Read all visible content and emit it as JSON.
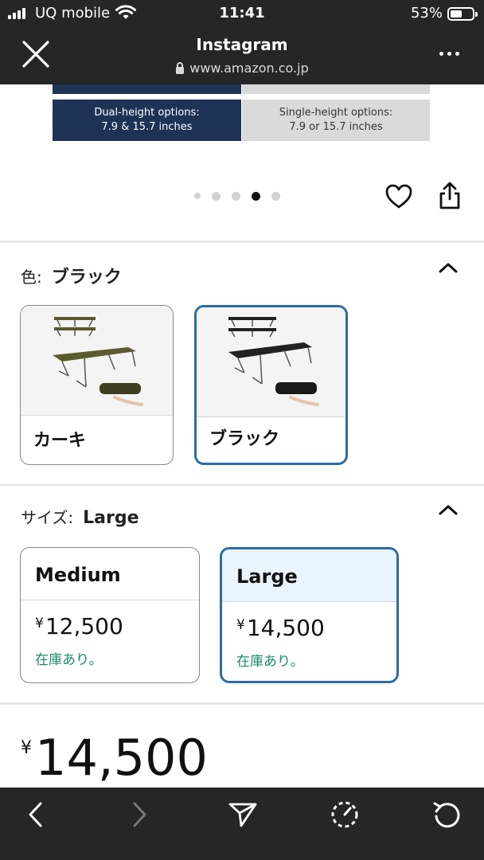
{
  "status_bar": {
    "carrier": "UQ mobile",
    "time": "11:41",
    "battery_pct": "53%",
    "battery_level": 0.53
  },
  "browser": {
    "title": "Instagram",
    "url": "www.amazon.co.jp"
  },
  "product_image": {
    "option_dual": "Dual-height options:\n7.9 & 15.7 inches",
    "option_single": "Single-height options:\n7.9 or 15.7 inches",
    "carousel_total": 5,
    "carousel_active": 4
  },
  "color_section": {
    "label": "色:",
    "selected": "ブラック",
    "options": [
      {
        "name": "カーキ",
        "selected": false,
        "color": "#5b5a2e"
      },
      {
        "name": "ブラック",
        "selected": true,
        "color": "#222222"
      }
    ]
  },
  "size_section": {
    "label": "サイズ:",
    "selected": "Large",
    "options": [
      {
        "name": "Medium",
        "currency": "¥",
        "price": "12,500",
        "stock": "在庫あり。",
        "selected": false
      },
      {
        "name": "Large",
        "currency": "¥",
        "price": "14,500",
        "stock": "在庫あり。",
        "selected": true
      }
    ]
  },
  "price": {
    "currency": "¥",
    "amount": "14,500"
  },
  "colors": {
    "chrome": "#262626",
    "accent": "#2b6ca7",
    "stock": "#1f8a70",
    "navy": "#1d3355"
  },
  "icons": [
    "close-icon",
    "lock-icon",
    "more-icon",
    "heart-icon",
    "share-icon",
    "chevron-up-icon",
    "back-icon",
    "forward-icon",
    "send-icon",
    "dashed-circle-icon",
    "reload-icon"
  ]
}
